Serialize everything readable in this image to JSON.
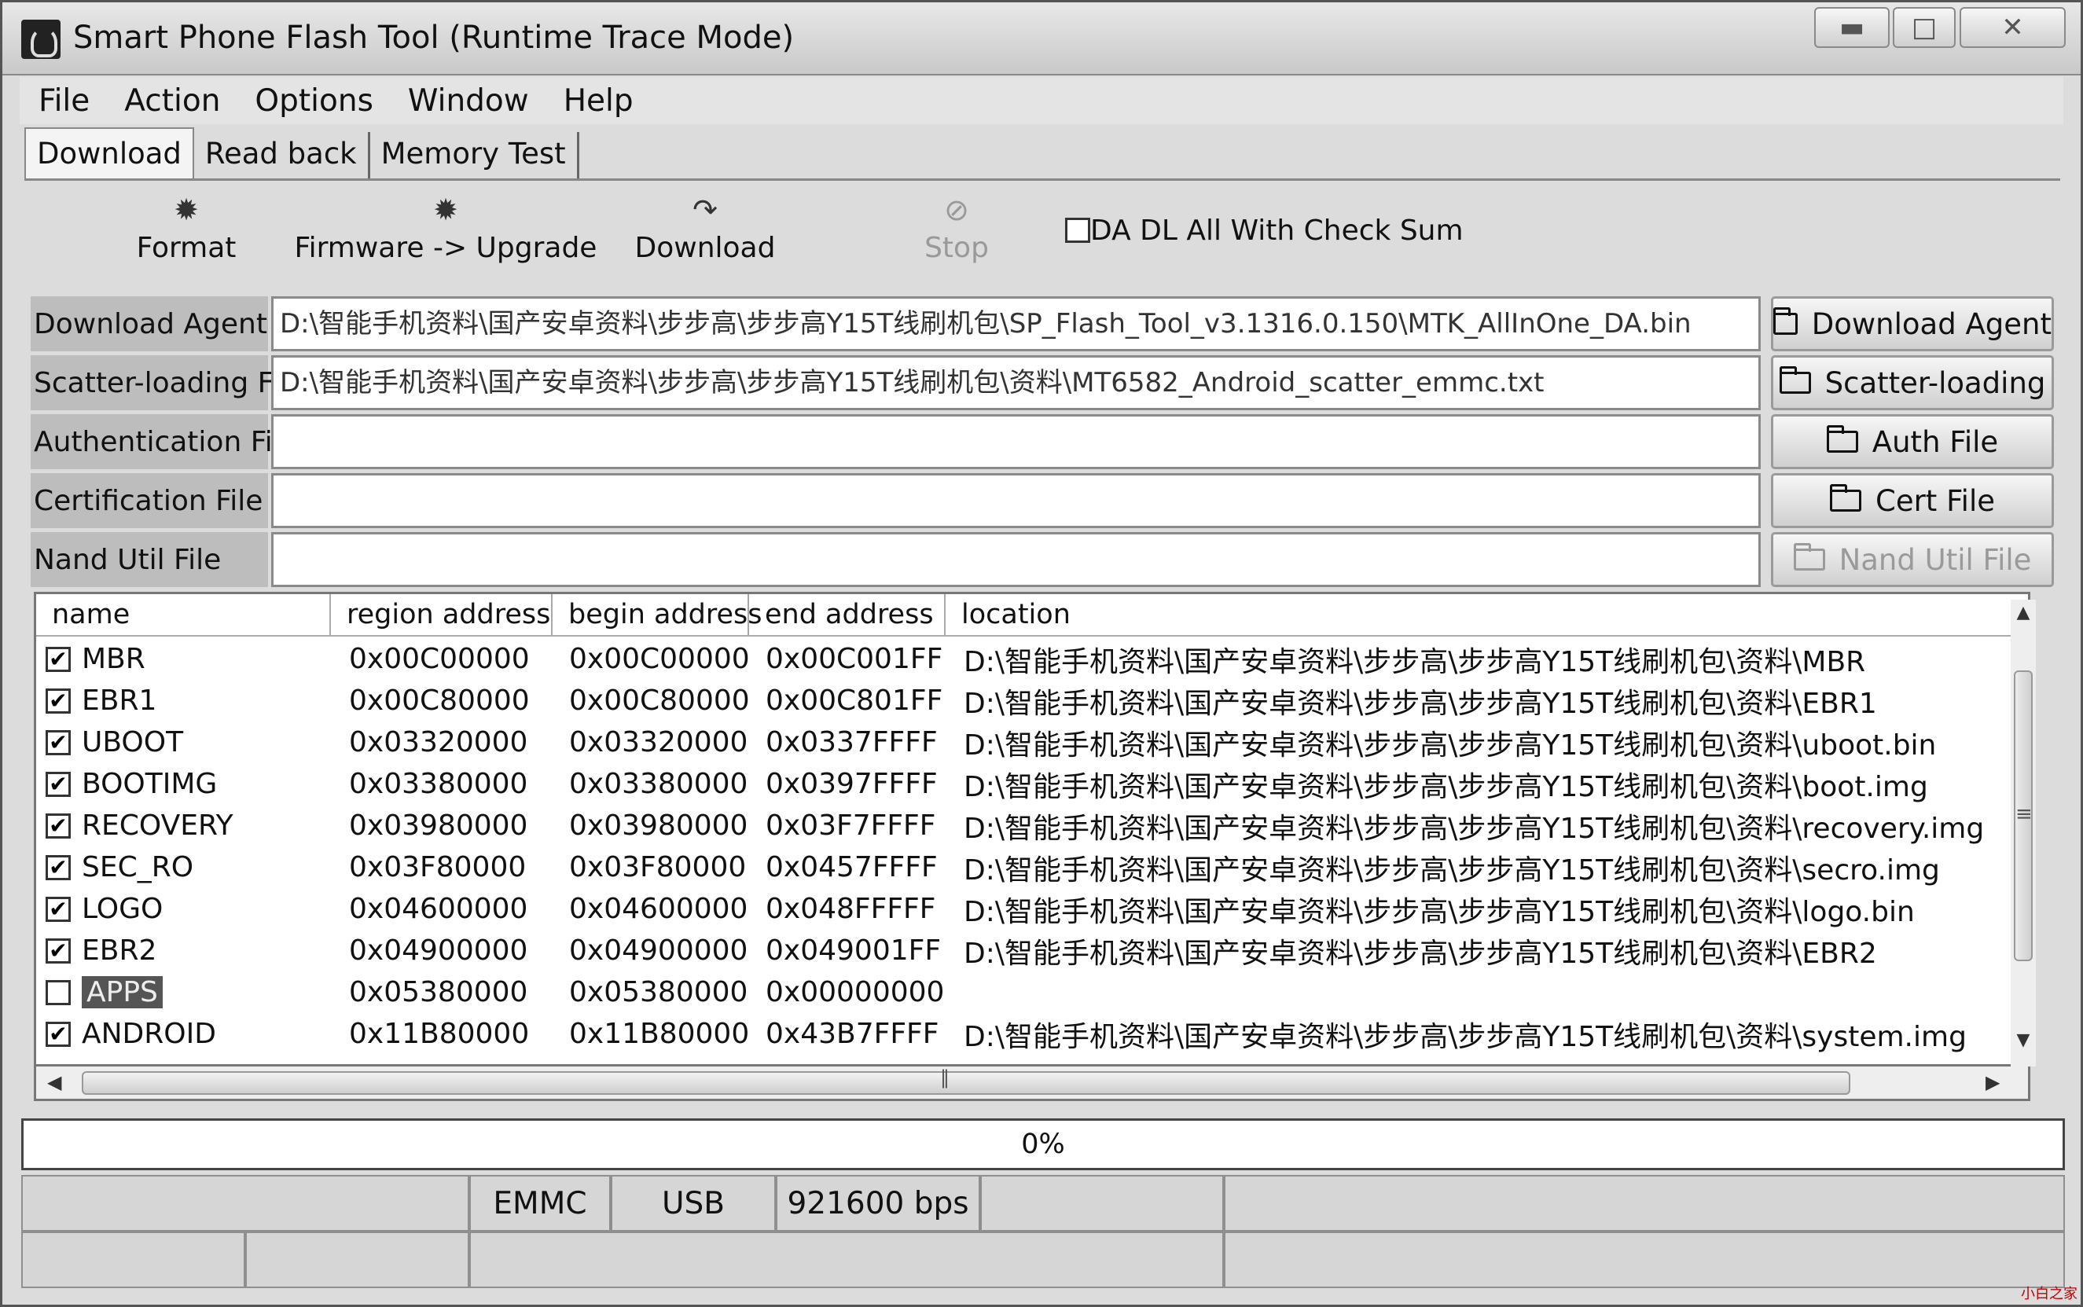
{
  "window": {
    "title": "Smart Phone Flash Tool (Runtime Trace Mode)",
    "minimize_icon": "minimize-icon",
    "maximize_icon": "maximize-icon",
    "close_icon": "close-icon"
  },
  "menu": [
    "File",
    "Action",
    "Options",
    "Window",
    "Help"
  ],
  "tabs": [
    {
      "label": "Download",
      "active": true
    },
    {
      "label": "Read back",
      "active": false
    },
    {
      "label": "Memory Test",
      "active": false
    }
  ],
  "toolbar": {
    "format": {
      "label": "Format",
      "icon": "gear-icon"
    },
    "firmware_upgrade": {
      "label": "Firmware -> Upgrade",
      "icon": "gear-icon"
    },
    "download": {
      "label": "Download",
      "icon": "download-icon"
    },
    "stop": {
      "label": "Stop",
      "icon": "stop-icon",
      "disabled": true
    },
    "checksum": {
      "label": "DA DL All With Check Sum",
      "checked": false
    }
  },
  "files": {
    "download_agent": {
      "label": "Download Agent",
      "value": "D:\\智能手机资料\\国产安卓资料\\步步高\\步步高Y15T线刷机包\\SP_Flash_Tool_v3.1316.0.150\\MTK_AllInOne_DA.bin",
      "button": "Download Agent"
    },
    "scatter": {
      "label": "Scatter-loading File",
      "value": "D:\\智能手机资料\\国产安卓资料\\步步高\\步步高Y15T线刷机包\\资料\\MT6582_Android_scatter_emmc.txt",
      "button": "Scatter-loading"
    },
    "auth": {
      "label": "Authentication File",
      "value": "",
      "button": "Auth File"
    },
    "cert": {
      "label": "Certification File",
      "value": "",
      "button": "Cert File"
    },
    "nand": {
      "label": "Nand Util File",
      "value": "",
      "button": "Nand Util File",
      "disabled": true
    }
  },
  "table": {
    "headers": [
      "name",
      "region address",
      "begin address",
      "end address",
      "location"
    ],
    "rows": [
      {
        "checked": true,
        "name": "MBR",
        "region": "0x00C00000",
        "begin": "0x00C00000",
        "end": "0x00C001FF",
        "location": "D:\\智能手机资料\\国产安卓资料\\步步高\\步步高Y15T线刷机包\\资料\\MBR"
      },
      {
        "checked": true,
        "name": "EBR1",
        "region": "0x00C80000",
        "begin": "0x00C80000",
        "end": "0x00C801FF",
        "location": "D:\\智能手机资料\\国产安卓资料\\步步高\\步步高Y15T线刷机包\\资料\\EBR1"
      },
      {
        "checked": true,
        "name": "UBOOT",
        "region": "0x03320000",
        "begin": "0x03320000",
        "end": "0x0337FFFF",
        "location": "D:\\智能手机资料\\国产安卓资料\\步步高\\步步高Y15T线刷机包\\资料\\uboot.bin"
      },
      {
        "checked": true,
        "name": "BOOTIMG",
        "region": "0x03380000",
        "begin": "0x03380000",
        "end": "0x0397FFFF",
        "location": "D:\\智能手机资料\\国产安卓资料\\步步高\\步步高Y15T线刷机包\\资料\\boot.img"
      },
      {
        "checked": true,
        "name": "RECOVERY",
        "region": "0x03980000",
        "begin": "0x03980000",
        "end": "0x03F7FFFF",
        "location": "D:\\智能手机资料\\国产安卓资料\\步步高\\步步高Y15T线刷机包\\资料\\recovery.img"
      },
      {
        "checked": true,
        "name": "SEC_RO",
        "region": "0x03F80000",
        "begin": "0x03F80000",
        "end": "0x0457FFFF",
        "location": "D:\\智能手机资料\\国产安卓资料\\步步高\\步步高Y15T线刷机包\\资料\\secro.img"
      },
      {
        "checked": true,
        "name": "LOGO",
        "region": "0x04600000",
        "begin": "0x04600000",
        "end": "0x048FFFFF",
        "location": "D:\\智能手机资料\\国产安卓资料\\步步高\\步步高Y15T线刷机包\\资料\\logo.bin"
      },
      {
        "checked": true,
        "name": "EBR2",
        "region": "0x04900000",
        "begin": "0x04900000",
        "end": "0x049001FF",
        "location": "D:\\智能手机资料\\国产安卓资料\\步步高\\步步高Y15T线刷机包\\资料\\EBR2"
      },
      {
        "checked": false,
        "name": "APPS",
        "region": "0x05380000",
        "begin": "0x05380000",
        "end": "0x00000000",
        "location": "",
        "selected": true
      },
      {
        "checked": true,
        "name": "ANDROID",
        "region": "0x11B80000",
        "begin": "0x11B80000",
        "end": "0x43B7FFFF",
        "location": "D:\\智能手机资料\\国产安卓资料\\步步高\\步步高Y15T线刷机包\\资料\\system.img"
      }
    ]
  },
  "progress": {
    "text": "0%",
    "value": 0,
    "fill_color": "#3a7bd5"
  },
  "status": {
    "storage": "EMMC",
    "connection": "USB",
    "baud": "921600 bps"
  },
  "watermark": "小白之家"
}
